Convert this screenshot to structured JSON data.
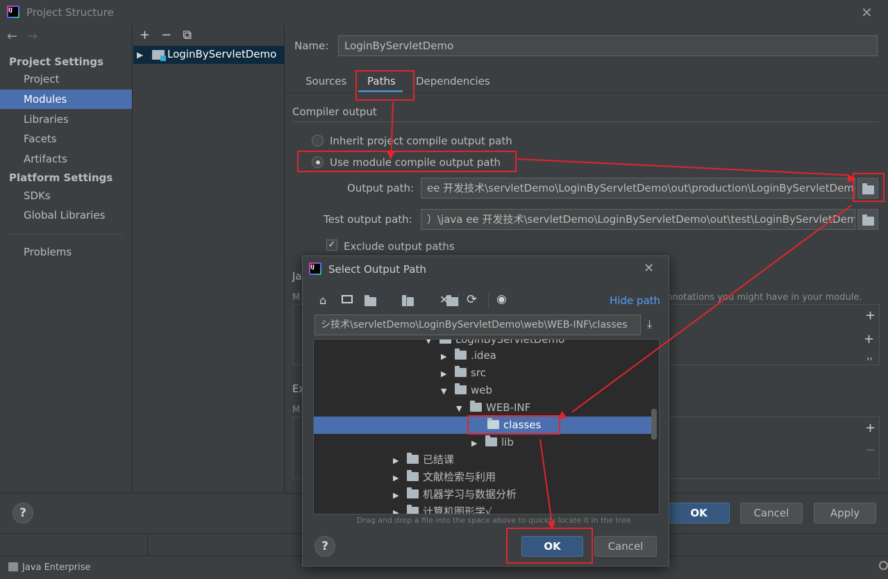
{
  "window": {
    "title": "Project Structure",
    "close": "✕"
  },
  "nav": {
    "back": "←",
    "forward": "→"
  },
  "sidebar": {
    "section1": "Project Settings",
    "items1": [
      "Project",
      "Modules",
      "Libraries",
      "Facets",
      "Artifacts"
    ],
    "section2": "Platform Settings",
    "items2": [
      "SDKs",
      "Global Libraries"
    ],
    "problems": "Problems",
    "selected": "Modules"
  },
  "modules_toolbar": {
    "add": "+",
    "remove": "−",
    "copy": "⧉"
  },
  "module_tree": {
    "item": "LoginByServletDemo"
  },
  "module": {
    "name_label": "Name:",
    "name_value": "LoginByServletDemo",
    "tabs": [
      "Sources",
      "Paths",
      "Dependencies"
    ],
    "active_tab": "Paths",
    "compiler_output_label": "Compiler output",
    "radio_inherit": "Inherit project compile output path",
    "radio_module": "Use module compile output path",
    "output_path_label": "Output path:",
    "output_path_value": "ee 开发技术\\servletDemo\\LoginByServletDemo\\out\\production\\LoginByServletDemo",
    "test_output_label": "Test output path:",
    "test_output_value": "）\\java ee 开发技术\\servletDemo\\LoginByServletDemo\\out\\test\\LoginByServletDemo",
    "exclude_label": "Exclude output paths",
    "exclude_checked": true,
    "partial_ja": "Ja",
    "partial_m1": "M",
    "partial_ex": "Ex",
    "partial_m2": "M",
    "annotations_text": "nnotations you might have in your module."
  },
  "footer": {
    "help": "?",
    "ok": "OK",
    "cancel": "Cancel",
    "apply": "Apply"
  },
  "statusbar": {
    "java_enterprise": "Java Enterprise"
  },
  "dialog": {
    "title": "Select Output Path",
    "close": "✕",
    "hide_path": "Hide path",
    "path_value": "シ技术\\servletDemo\\LoginByServletDemo\\web\\WEB-INF\\classes",
    "hint": "Drag and drop a file into the space above to quickly locate it in the tree",
    "help": "?",
    "ok": "OK",
    "cancel": "Cancel",
    "tree": {
      "root": "LoginByServletDemo",
      "idea": ".idea",
      "src": "src",
      "web": "web",
      "webinf": "WEB-INF",
      "classes": "classes",
      "lib": "lib",
      "f1": "已结课",
      "f2": "文献检索与利用",
      "f3": "机器学习与数据分析",
      "f4": "计算机图形学√"
    }
  },
  "colors": {
    "accent": "#4b6eaf",
    "annotation_red": "#e5242b",
    "link": "#589df6"
  }
}
